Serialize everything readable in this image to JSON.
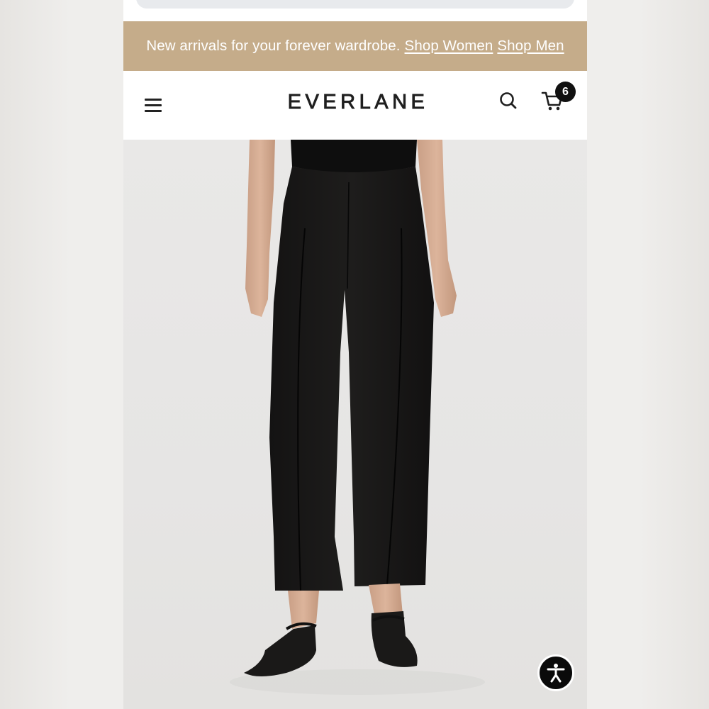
{
  "promo_banner": {
    "text": "New arrivals for your forever wardrobe.",
    "links": [
      "Shop Women",
      "Shop Men"
    ],
    "background": "#c5ac8a"
  },
  "header": {
    "logo": "EVERLANE",
    "icons": [
      "menu-icon",
      "search-icon",
      "cart-icon"
    ],
    "cart_count": "6"
  },
  "product_image": {
    "subject": "black-cropped-flare-pants-icon"
  },
  "accessibility_button": {
    "icon": "accessibility-icon"
  }
}
